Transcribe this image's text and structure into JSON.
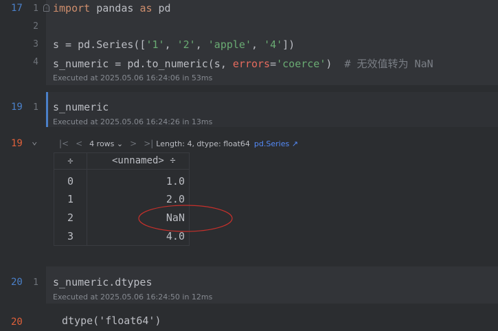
{
  "cells": [
    {
      "exec_count": "17",
      "lines": [
        {
          "no": "1",
          "tokens": [
            {
              "t": "import",
              "c": "kw"
            },
            {
              "t": " pandas ",
              "c": ""
            },
            {
              "t": "as",
              "c": "kw"
            },
            {
              "t": " pd",
              "c": ""
            }
          ]
        },
        {
          "no": "2",
          "tokens": []
        },
        {
          "no": "3",
          "tokens": [
            {
              "t": "s = pd.Series([",
              "c": ""
            },
            {
              "t": "'1'",
              "c": "str"
            },
            {
              "t": ", ",
              "c": ""
            },
            {
              "t": "'2'",
              "c": "str"
            },
            {
              "t": ", ",
              "c": ""
            },
            {
              "t": "'apple'",
              "c": "str"
            },
            {
              "t": ", ",
              "c": ""
            },
            {
              "t": "'4'",
              "c": "str"
            },
            {
              "t": "])",
              "c": ""
            }
          ]
        },
        {
          "no": "4",
          "tokens": [
            {
              "t": "s_numeric = pd.to_numeric(s, ",
              "c": ""
            },
            {
              "t": "errors",
              "c": "param"
            },
            {
              "t": "=",
              "c": ""
            },
            {
              "t": "'coerce'",
              "c": "str"
            },
            {
              "t": ")  ",
              "c": ""
            },
            {
              "t": "# 无效值转为 NaN",
              "c": "cm"
            }
          ]
        }
      ],
      "meta": "Executed at 2025.05.06 16:24:06 in 53ms"
    },
    {
      "exec_count": "19",
      "lines": [
        {
          "no": "1",
          "tokens": [
            {
              "t": "s_numeric",
              "c": ""
            }
          ]
        }
      ],
      "meta": "Executed at 2025.05.06 16:24:26 in 13ms"
    },
    {
      "exec_count": "20",
      "lines": [
        {
          "no": "1",
          "tokens": [
            {
              "t": "s_numeric.dtypes",
              "c": ""
            }
          ]
        }
      ],
      "meta": "Executed at 2025.05.06 16:24:50 in 12ms"
    }
  ],
  "output1": {
    "exec_count": "19",
    "collapse_glyph": "⌄",
    "toolbar": {
      "first": "|<",
      "prev": "<",
      "rows": "4 rows ⌄",
      "next": ">",
      "last": ">|",
      "info": "Length: 4, dtype: float64",
      "link": "pd.Series ↗"
    },
    "table": {
      "sort_glyph": "÷",
      "column": "<unnamed> ÷",
      "rows": [
        {
          "index": "0",
          "value": "1.0"
        },
        {
          "index": "1",
          "value": "2.0"
        },
        {
          "index": "2",
          "value": "NaN"
        },
        {
          "index": "3",
          "value": "4.0"
        }
      ]
    }
  },
  "output2": {
    "exec_count": "20",
    "text": "dtype('float64')"
  },
  "colors": {
    "exec_count_done": "#4b80c9",
    "exec_count_output": "#e0603a",
    "annotation": "#c8302b"
  }
}
